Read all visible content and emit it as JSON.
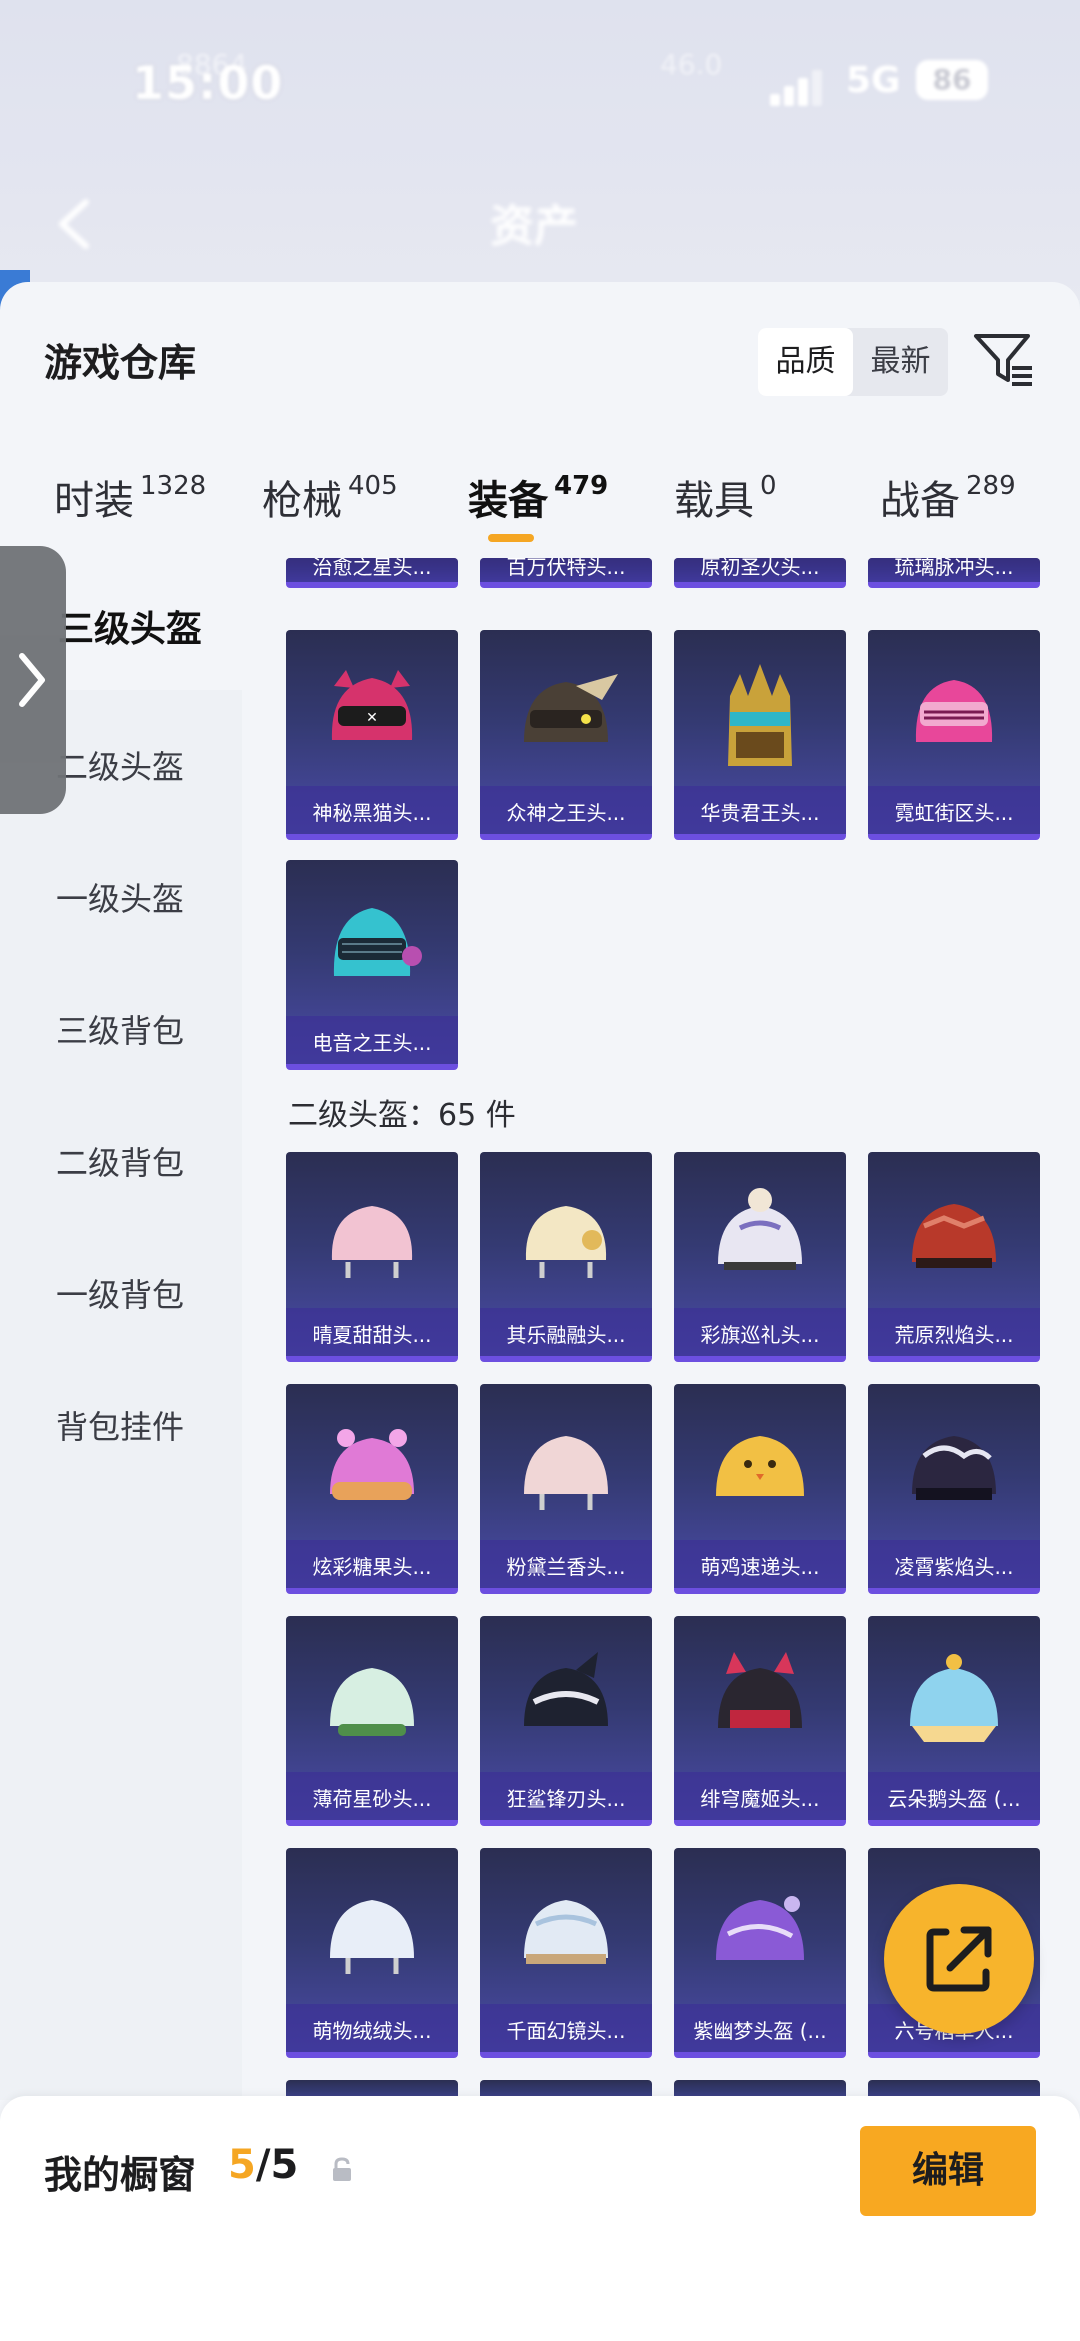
{
  "status_bar": {
    "time": "15:00",
    "network": "5G",
    "battery": "86",
    "ghost_left": "8864",
    "ghost_right": "46.0"
  },
  "header": {
    "title": "资产"
  },
  "panel": {
    "title": "游戏仓库",
    "sort_options": [
      "品质",
      "最新"
    ],
    "sort_active": "品质"
  },
  "tabs": [
    {
      "label": "时装",
      "count": "1328"
    },
    {
      "label": "枪械",
      "count": "405"
    },
    {
      "label": "装备",
      "count": "479"
    },
    {
      "label": "载具",
      "count": "0"
    },
    {
      "label": "战备",
      "count": "289"
    }
  ],
  "active_tab": "装备",
  "sidebar": {
    "items": [
      "三级头盔",
      "二级头盔",
      "一级头盔",
      "三级背包",
      "二级背包",
      "一级背包",
      "背包挂件"
    ],
    "active_visible_text": "三级头盔"
  },
  "section_lvl3": {
    "cut_items": [
      "治愈之星头...",
      "百万伏特头...",
      "原初圣火头...",
      "琉璃脉冲头..."
    ],
    "items": [
      "神秘黑猫头...",
      "众神之王头...",
      "华贵君王头...",
      "霓虹街区头...",
      "电音之王头..."
    ]
  },
  "section_lvl2": {
    "label": "二级头盔：65 件",
    "items": [
      "晴夏甜甜头...",
      "其乐融融头...",
      "彩旗巡礼头...",
      "荒原烈焰头...",
      "炫彩糖果头...",
      "粉黛兰香头...",
      "萌鸡速递头...",
      "凌霄紫焰头...",
      "薄荷星砂头...",
      "狂鲨锋刃头...",
      "绯穹魔姬头...",
      "云朵鹅头盔 (...",
      "萌物绒绒头...",
      "千面幻镜头...",
      "紫幽梦头盔 (...",
      "六号稻草人..."
    ]
  },
  "bottom_bar": {
    "label": "我的橱窗",
    "count_current": "5",
    "count_total": "/5",
    "edit_label": "编辑"
  },
  "colors": {
    "accent": "#f5a623",
    "card_top": "#2b2e52",
    "card_bottom": "#4a4ba6",
    "fab": "#f7b42c"
  }
}
